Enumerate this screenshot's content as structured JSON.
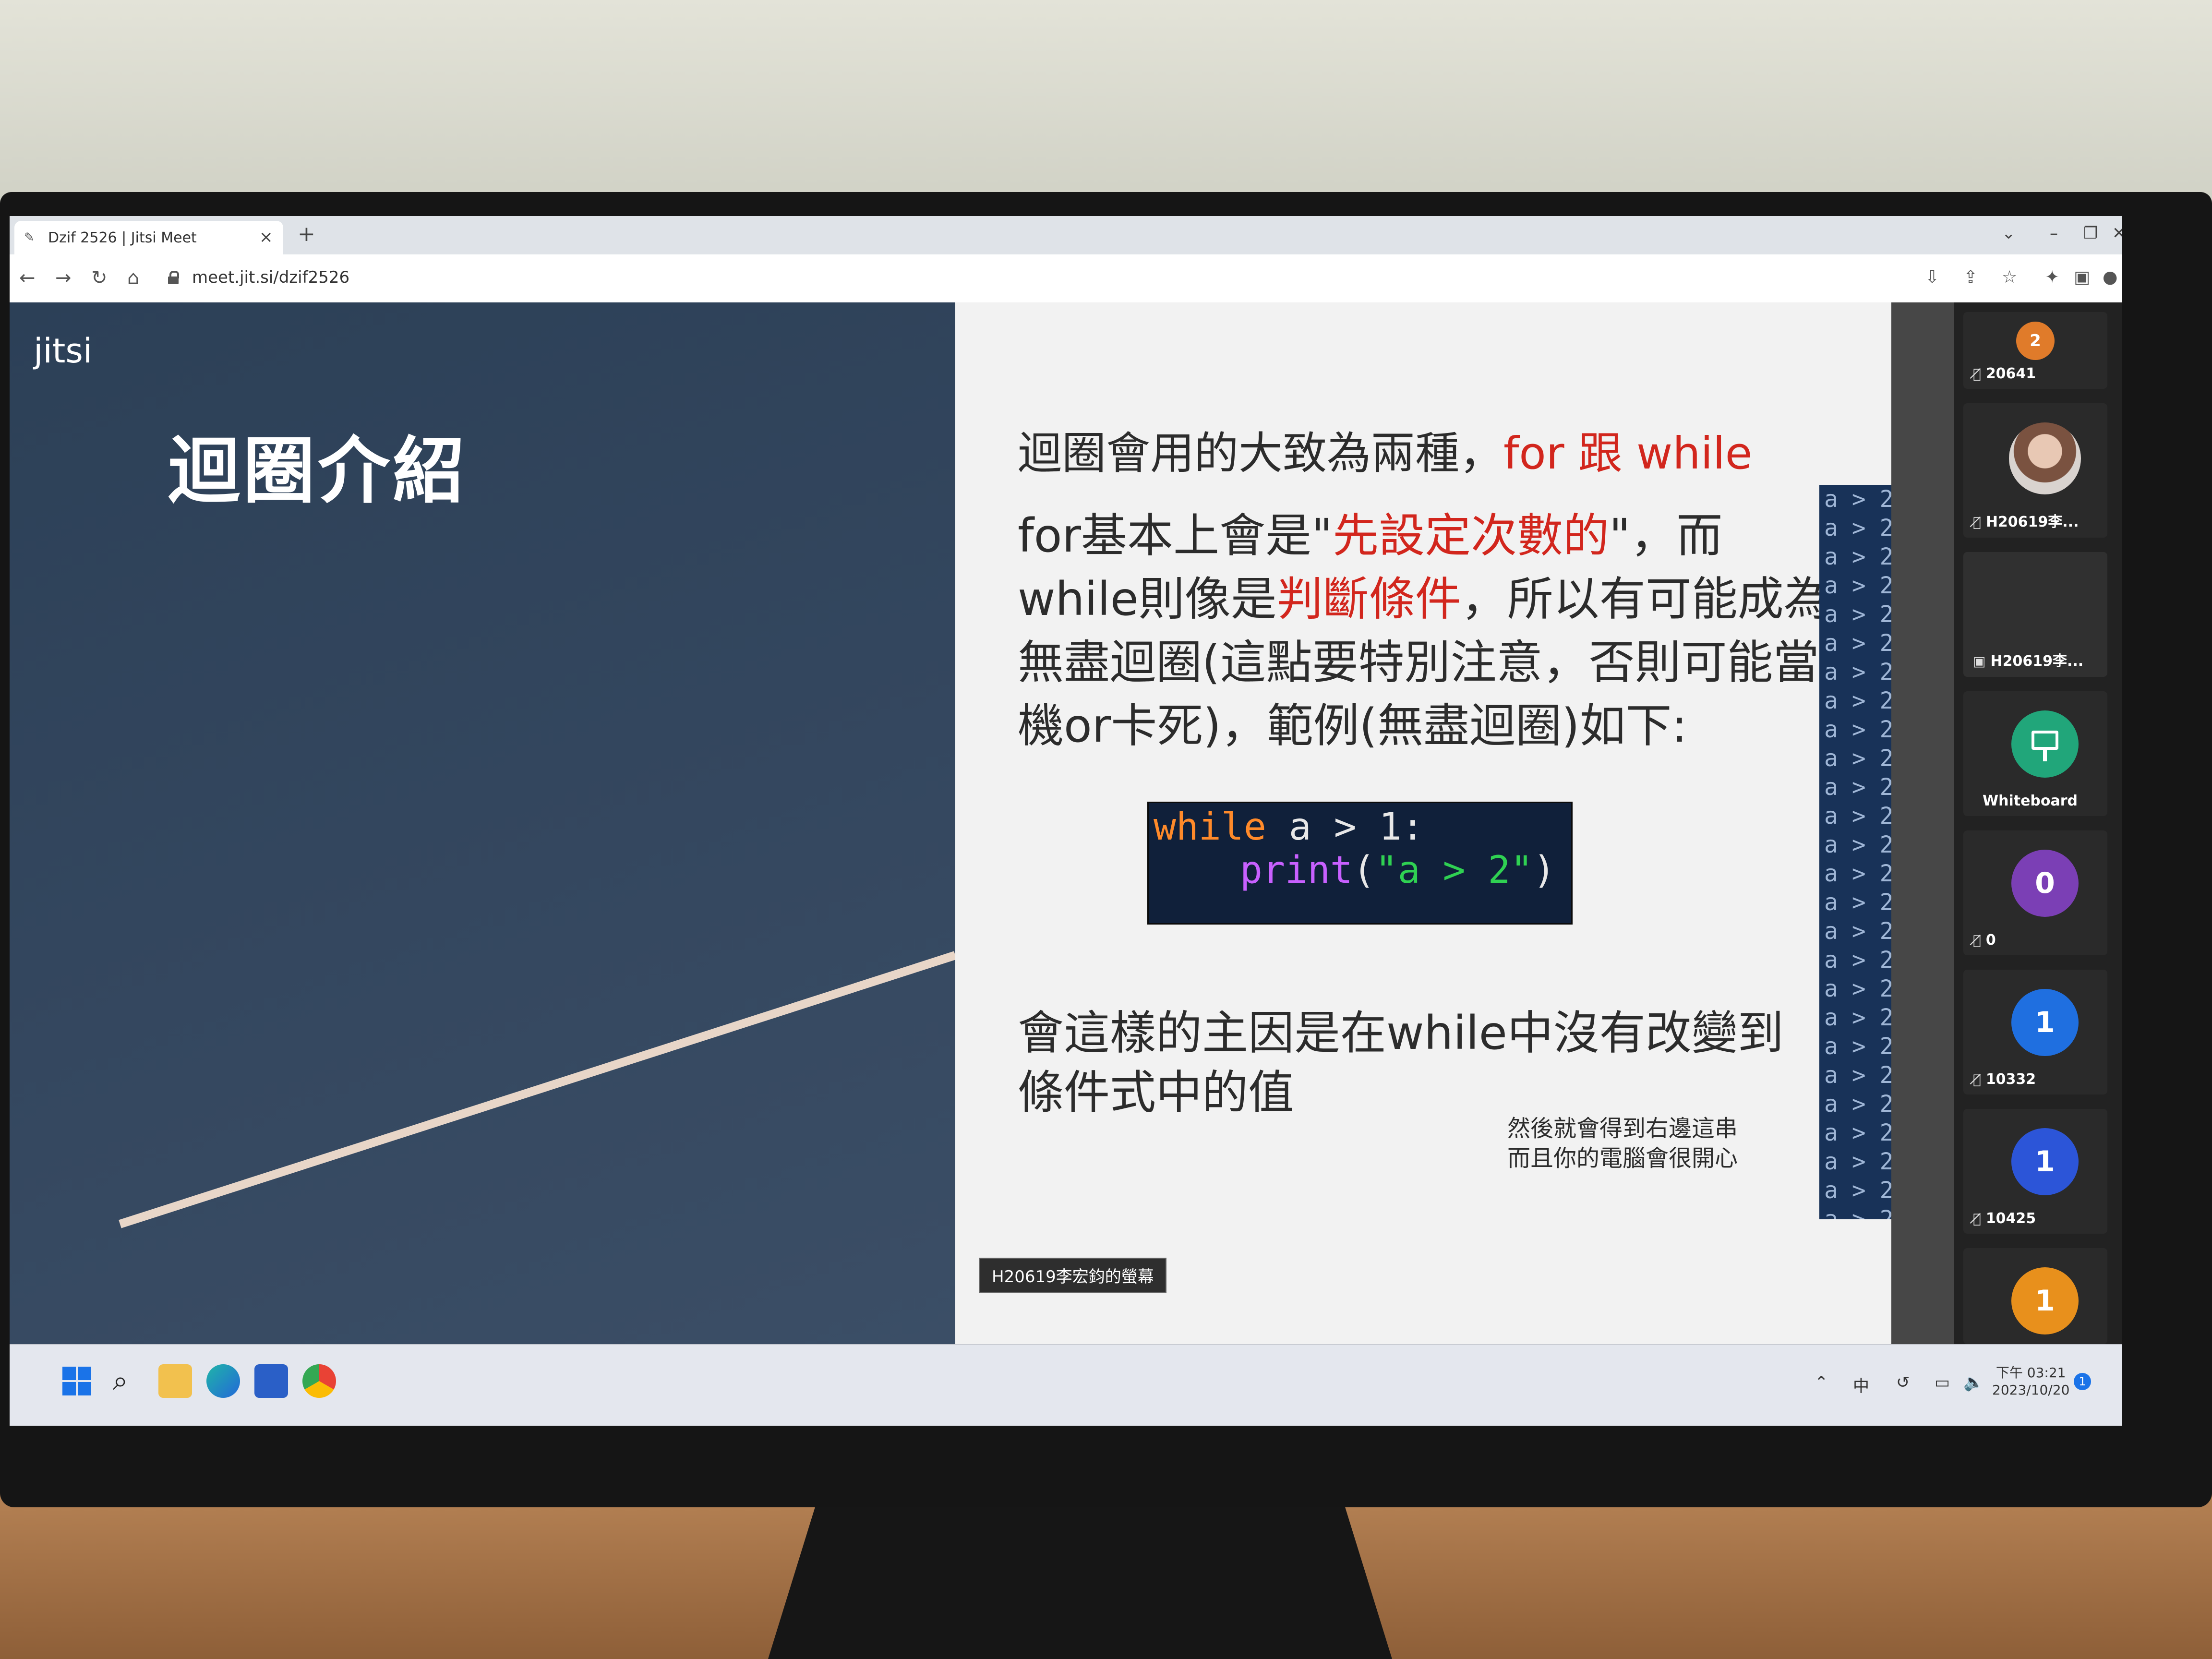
{
  "browser": {
    "tab_title": "Dzif 2526 | Jitsi Meet",
    "new_tab": "+",
    "url": "meet.jit.si/dzif2526"
  },
  "meeting": {
    "logo_text": "jitsi",
    "share_label": "H20619李宏鈞的螢幕"
  },
  "slide": {
    "title": "迴圈介紹",
    "line1_prefix": "迴圈會用的大致為兩種，",
    "line1_for": "for",
    "line1_mid": " 跟 ",
    "line1_while": "while",
    "p1_a": "for基本上會是\"",
    "p1_red1": "先設定次數的",
    "p1_b": "\"，而while則像是",
    "p1_red2": "判斷條件",
    "p1_c": "，所以有可能成為無盡迴圈(這點要特別注意，否則可能當機or卡死)，範例(無盡迴圈)如下:",
    "code_kw": "while",
    "code_rest1": " a > 1:",
    "code_fn": "print",
    "code_open": "(",
    "code_str": "\"a > 2\"",
    "code_close": ")",
    "p2": "會這樣的主因是在while中沒有改變到條件式中的值",
    "note_line1": "然後就會得到右邊這串",
    "note_line2": "而且你的電腦會很開心",
    "output_line": "a > 2"
  },
  "participants": [
    {
      "name": "20641",
      "avatar": "2",
      "color": "#e07b2a"
    },
    {
      "name": "H20619李..."
    },
    {
      "name": "H20619李..."
    },
    {
      "name": "Whiteboard"
    },
    {
      "name": "0",
      "avatar": "0",
      "color": "#7b3fb5"
    },
    {
      "name": "10332",
      "avatar": "1",
      "color": "#1f6fe0"
    },
    {
      "name": "10425",
      "avatar": "1",
      "color": "#2c55d8"
    },
    {
      "name": "",
      "avatar": "1",
      "color": "#e8901c"
    }
  ],
  "taskbar": {
    "ime": "中",
    "time": "下午 03:21",
    "date": "2023/10/20",
    "notifications": "1"
  }
}
